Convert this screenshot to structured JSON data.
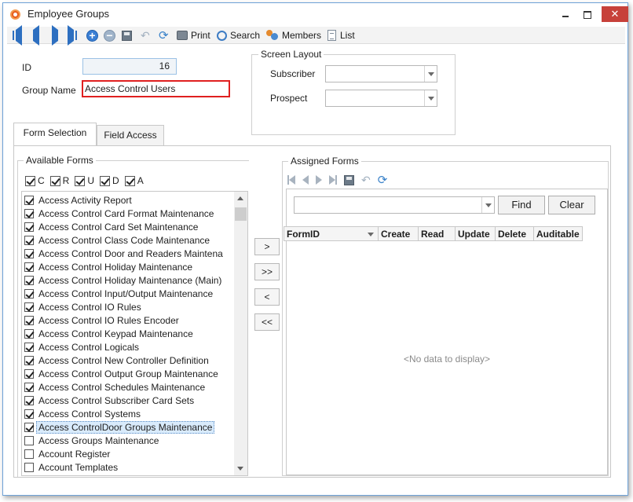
{
  "window": {
    "title": "Employee Groups",
    "close_glyph": "✕"
  },
  "toolbar": {
    "print_label": "Print",
    "search_label": "Search",
    "members_label": "Members",
    "list_label": "List",
    "add_glyph": "+",
    "remove_glyph": "−",
    "undo_glyph": "↶",
    "refresh_glyph": "⟳"
  },
  "record": {
    "id_label": "ID",
    "id_value": "16",
    "group_name_label": "Group Name",
    "group_name_value": "Access Control Users"
  },
  "screen_layout": {
    "title": "Screen Layout",
    "subscriber_label": "Subscriber",
    "subscriber_value": "",
    "prospect_label": "Prospect",
    "prospect_value": ""
  },
  "tabs": [
    {
      "label": "Form Selection",
      "active": true
    },
    {
      "label": "Field Access",
      "active": false
    }
  ],
  "available_forms": {
    "title": "Available Forms",
    "permissions": [
      {
        "label": "C",
        "checked": true
      },
      {
        "label": "R",
        "checked": true
      },
      {
        "label": "U",
        "checked": true
      },
      {
        "label": "D",
        "checked": true
      },
      {
        "label": "A",
        "checked": true
      }
    ],
    "items": [
      {
        "label": "Access Activity Report",
        "checked": true
      },
      {
        "label": "Access Control Card Format Maintenance",
        "checked": true
      },
      {
        "label": "Access Control Card Set Maintenance",
        "checked": true
      },
      {
        "label": "Access Control Class Code Maintenance",
        "checked": true
      },
      {
        "label": "Access Control Door and Readers Maintena",
        "checked": true
      },
      {
        "label": "Access Control Holiday Maintenance",
        "checked": true
      },
      {
        "label": "Access Control Holiday Maintenance (Main)",
        "checked": true
      },
      {
        "label": "Access Control Input/Output Maintenance",
        "checked": true
      },
      {
        "label": "Access Control IO Rules",
        "checked": true
      },
      {
        "label": "Access Control IO Rules Encoder",
        "checked": true
      },
      {
        "label": "Access Control Keypad Maintenance",
        "checked": true
      },
      {
        "label": "Access Control Logicals",
        "checked": true
      },
      {
        "label": "Access Control New Controller Definition",
        "checked": true
      },
      {
        "label": "Access Control Output Group Maintenance",
        "checked": true
      },
      {
        "label": "Access Control Schedules Maintenance",
        "checked": true
      },
      {
        "label": "Access Control Subscriber Card Sets",
        "checked": true
      },
      {
        "label": "Access Control Systems",
        "checked": true
      },
      {
        "label": "Access ControlDoor Groups Maintenance",
        "checked": true,
        "selected": true
      },
      {
        "label": "Access Groups Maintenance",
        "checked": false
      },
      {
        "label": "Account Register",
        "checked": false
      },
      {
        "label": "Account Templates",
        "checked": false
      }
    ]
  },
  "transfer_buttons": {
    "add_one": ">",
    "add_all": ">>",
    "remove_one": "<",
    "remove_all": "<<"
  },
  "assigned_forms": {
    "title": "Assigned Forms",
    "find_value": "",
    "find_label": "Find",
    "clear_label": "Clear",
    "columns": [
      "FormID",
      "Create",
      "Read",
      "Update",
      "Delete",
      "Auditable"
    ],
    "empty_text": "<No data to display>"
  }
}
